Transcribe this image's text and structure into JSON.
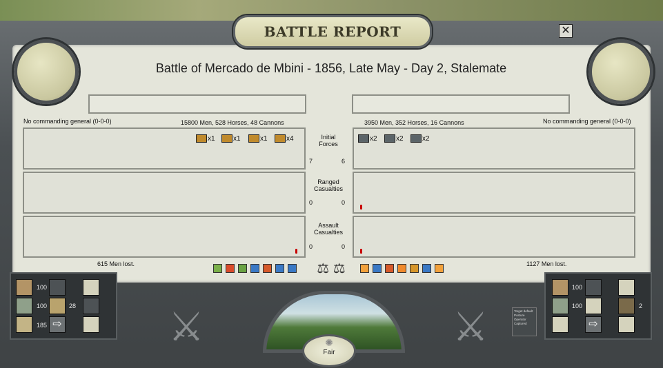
{
  "header": {
    "title": "BATTLE REPORT",
    "close_icon": "close-icon"
  },
  "battle": {
    "title": "Battle of Mercado de Mbini - 1856, Late May - Day 2, Stalemate"
  },
  "left": {
    "general": "No commanding general (0-0-0)",
    "forces": "15800 Men, 528 Horses, 48 Cannons",
    "units": [
      {
        "icon": "line-infantry-icon",
        "color": "#c08a2c",
        "count": "x1"
      },
      {
        "icon": "line-infantry-icon",
        "color": "#c08a2c",
        "count": "x1"
      },
      {
        "icon": "artillery-icon",
        "color": "#c08a2c",
        "count": "x1"
      },
      {
        "icon": "cavalry-icon",
        "color": "#c08a2c",
        "count": "x4"
      }
    ],
    "initial": "7",
    "ranged": "0",
    "assault": "0",
    "lost": "615 Men lost.",
    "stats": [
      "100",
      "100",
      "28",
      "185"
    ]
  },
  "right": {
    "general": "No commanding general (0-0-0)",
    "forces": "3950 Men, 352 Horses, 16 Cannons",
    "units": [
      {
        "icon": "artillery-icon",
        "color": "#5b6468",
        "count": "x2"
      },
      {
        "icon": "cavalry-icon",
        "color": "#5b6468",
        "count": "x2"
      },
      {
        "icon": "cavalry-icon",
        "color": "#5b6468",
        "count": "x2"
      }
    ],
    "initial": "6",
    "ranged": "0",
    "assault": "0",
    "lost": "1127 Men lost.",
    "stats": [
      "100",
      "100",
      "2"
    ]
  },
  "labels": {
    "initial": [
      "Initial",
      "Forces"
    ],
    "ranged": [
      "Ranged",
      "Casualties"
    ],
    "assault": [
      "Assault",
      "Casualties"
    ]
  },
  "weather": "Fair",
  "legend": [
    "Target default",
    "Posture",
    "Operator",
    "Captured"
  ],
  "colors": {
    "left_accent": "#c08a2c",
    "right_accent": "#5b6468",
    "casualty": "#c80000"
  }
}
